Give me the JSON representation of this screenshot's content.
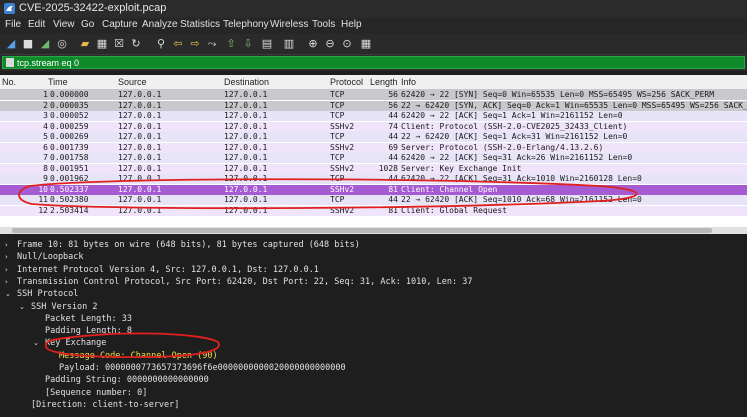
{
  "window": {
    "title": "CVE-2025-32422-exploit.pcap"
  },
  "menu": [
    "File",
    "Edit",
    "View",
    "Go",
    "Capture",
    "Analyze",
    "Statistics",
    "Telephony",
    "Wireless",
    "Tools",
    "Help"
  ],
  "toolbar": {
    "icons": [
      "shark-fin-start-icon",
      "stop-icon",
      "restart-icon",
      "options-icon",
      "open-folder-icon",
      "save-icon",
      "close-file-icon",
      "reload-icon",
      "find-icon",
      "back-icon",
      "forward-icon",
      "go-to-packet-icon",
      "first-packet-icon",
      "last-packet-icon",
      "autoscroll-icon",
      "colorize-icon",
      "zoom-in-icon",
      "zoom-out-icon",
      "normal-size-icon",
      "resize-columns-icon"
    ]
  },
  "filter": {
    "value": "tcp.stream eq 0"
  },
  "packet_list": {
    "columns": [
      "No.",
      "Time",
      "Source",
      "Destination",
      "Protocol",
      "Length",
      "Info"
    ],
    "rows": [
      {
        "no": "1",
        "time": "0.000000",
        "src": "127.0.0.1",
        "dst": "127.0.0.1",
        "proto": "TCP",
        "len": "56",
        "info": "62420 → 22 [SYN] Seq=0 Win=65535 Len=0 MSS=65495 WS=256 SACK_PERM",
        "style": "gray"
      },
      {
        "no": "2",
        "time": "0.000035",
        "src": "127.0.0.1",
        "dst": "127.0.0.1",
        "proto": "TCP",
        "len": "56",
        "info": "22 → 62420 [SYN, ACK] Seq=0 Ack=1 Win=65535 Len=0 MSS=65495 WS=256 SACK_PERM",
        "style": "gray"
      },
      {
        "no": "3",
        "time": "0.000052",
        "src": "127.0.0.1",
        "dst": "127.0.0.1",
        "proto": "TCP",
        "len": "44",
        "info": "62420 → 22 [ACK] Seq=1 Ack=1 Win=2161152 Len=0",
        "style": "tcp"
      },
      {
        "no": "4",
        "time": "0.000259",
        "src": "127.0.0.1",
        "dst": "127.0.0.1",
        "proto": "SSHv2",
        "len": "74",
        "info": "Client: Protocol (SSH-2.0-CVE2025_32433_Client)",
        "style": "ssh"
      },
      {
        "no": "5",
        "time": "0.000269",
        "src": "127.0.0.1",
        "dst": "127.0.0.1",
        "proto": "TCP",
        "len": "44",
        "info": "22 → 62420 [ACK] Seq=1 Ack=31 Win=2161152 Len=0",
        "style": "tcp"
      },
      {
        "no": "6",
        "time": "0.001739",
        "src": "127.0.0.1",
        "dst": "127.0.0.1",
        "proto": "SSHv2",
        "len": "69",
        "info": "Server: Protocol (SSH-2.0-Erlang/4.13.2.6)",
        "style": "ssh"
      },
      {
        "no": "7",
        "time": "0.001758",
        "src": "127.0.0.1",
        "dst": "127.0.0.1",
        "proto": "TCP",
        "len": "44",
        "info": "62420 → 22 [ACK] Seq=31 Ack=26 Win=2161152 Len=0",
        "style": "tcp"
      },
      {
        "no": "8",
        "time": "0.001951",
        "src": "127.0.0.1",
        "dst": "127.0.0.1",
        "proto": "SSHv2",
        "len": "1028",
        "info": "Server: Key Exchange Init",
        "style": "ssh"
      },
      {
        "no": "9",
        "time": "0.001962",
        "src": "127.0.0.1",
        "dst": "127.0.0.1",
        "proto": "TCP",
        "len": "44",
        "info": "62420 → 22 [ACK] Seq=31 Ack=1010 Win=2160128 Len=0",
        "style": "tcp"
      },
      {
        "no": "10",
        "time": "0.502337",
        "src": "127.0.0.1",
        "dst": "127.0.0.1",
        "proto": "SSHv2",
        "len": "81",
        "info": "Client: Channel Open",
        "style": "sel"
      },
      {
        "no": "11",
        "time": "0.502380",
        "src": "127.0.0.1",
        "dst": "127.0.0.1",
        "proto": "TCP",
        "len": "44",
        "info": "22 → 62420 [ACK] Seq=1010 Ack=68 Win=2161152 Len=0",
        "style": "tcp"
      },
      {
        "no": "12",
        "time": "2.503414",
        "src": "127.0.0.1",
        "dst": "127.0.0.1",
        "proto": "SSHv2",
        "len": "81",
        "info": "Client: Global Request",
        "style": "ssh"
      }
    ]
  },
  "details": [
    {
      "indent": 0,
      "tri": "›",
      "text": "Frame 10: 81 bytes on wire (648 bits), 81 bytes captured (648 bits)"
    },
    {
      "indent": 0,
      "tri": "›",
      "text": "Null/Loopback"
    },
    {
      "indent": 0,
      "tri": "›",
      "text": "Internet Protocol Version 4, Src: 127.0.0.1, Dst: 127.0.0.1"
    },
    {
      "indent": 0,
      "tri": "›",
      "text": "Transmission Control Protocol, Src Port: 62420, Dst Port: 22, Seq: 31, Ack: 1010, Len: 37"
    },
    {
      "indent": 0,
      "tri": "⌄",
      "text": "SSH Protocol"
    },
    {
      "indent": 1,
      "tri": "⌄",
      "text": "SSH Version 2"
    },
    {
      "indent": 2,
      "tri": "",
      "text": "Packet Length: 33"
    },
    {
      "indent": 2,
      "tri": "",
      "text": "Padding Length: 8"
    },
    {
      "indent": 2,
      "tri": "⌄",
      "text": "Key Exchange"
    },
    {
      "indent": 3,
      "tri": "",
      "text": "Message Code: Channel Open (90)",
      "hl": true
    },
    {
      "indent": 3,
      "tri": "",
      "text": "Payload: 0000000773657373696f6e0000000000020000000000000"
    },
    {
      "indent": 2,
      "tri": "",
      "text": "Padding String: 0000000000000000"
    },
    {
      "indent": 2,
      "tri": "",
      "text": "[Sequence number: 0]"
    },
    {
      "indent": 1,
      "tri": "",
      "text": "[Direction: client-to-server]"
    }
  ],
  "annotation_color": "#e0201f",
  "filter_color": "#0f8a2a",
  "selected_row_color": "#a55cd3"
}
